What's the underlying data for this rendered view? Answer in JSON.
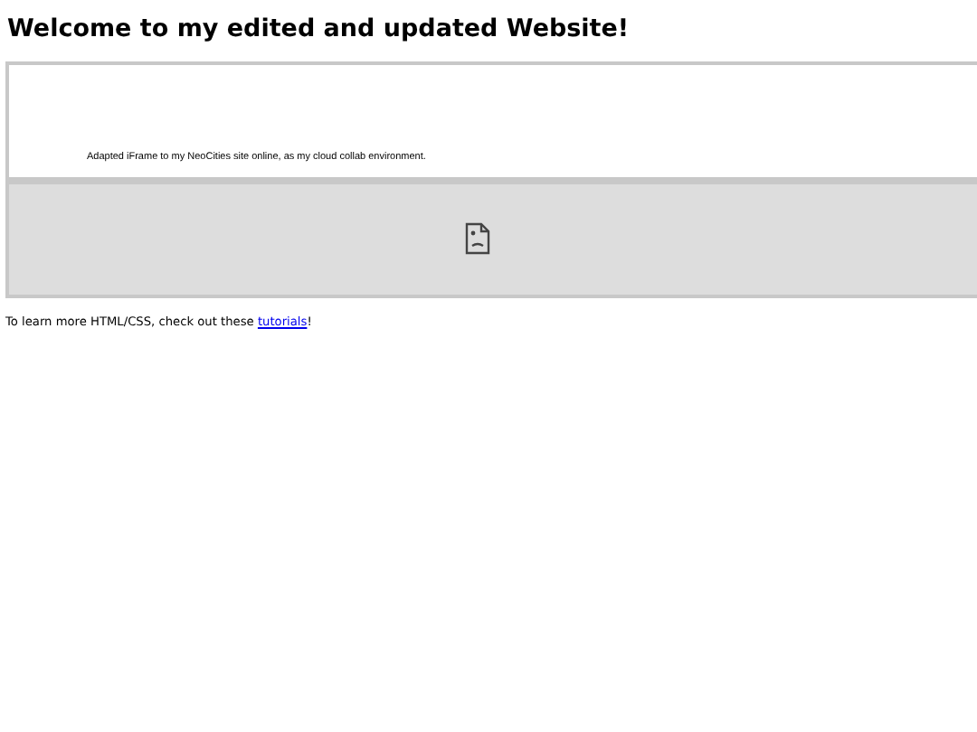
{
  "heading": "Welcome to my edited and updated Website!",
  "embedded_frame": {
    "text": "Adapted iFrame to my NeoCities site online, as my cloud collab environment."
  },
  "broken_frame": {
    "kind": "error"
  },
  "paragraph": {
    "before": "To learn more HTML/CSS, check out these ",
    "link": "tutorials",
    "after": "!"
  }
}
